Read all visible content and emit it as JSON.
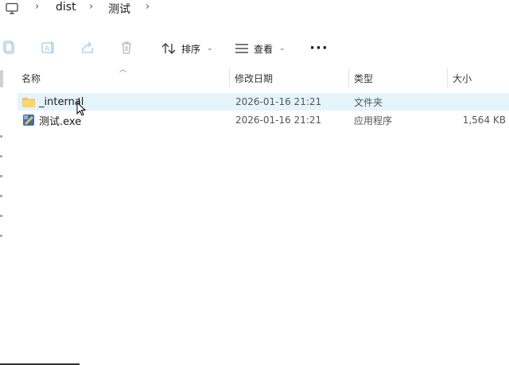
{
  "breadcrumb": {
    "separator": "›",
    "segments": [
      "dist",
      "测试"
    ]
  },
  "toolbar": {
    "sort_label": "排序",
    "view_label": "查看",
    "more_label": "···",
    "icons": [
      "copy-icon",
      "rename-icon",
      "share-icon",
      "delete-icon",
      "sort-icon",
      "view-icon",
      "more-icon"
    ]
  },
  "columns": {
    "name": "名称",
    "modified": "修改日期",
    "type": "类型",
    "size": "大小"
  },
  "files": [
    {
      "name": "_internal",
      "modified": "2026-01-16 21:21",
      "type": "文件夹",
      "size": "",
      "icon": "folder-icon",
      "selected": true
    },
    {
      "name": "测试.exe",
      "modified": "2026-01-16 21:21",
      "type": "应用程序",
      "size": "1,564 KB",
      "icon": "exe-icon",
      "selected": false
    }
  ],
  "colors": {
    "selection": "#e5f3fb",
    "folder": "#f4c64b"
  }
}
